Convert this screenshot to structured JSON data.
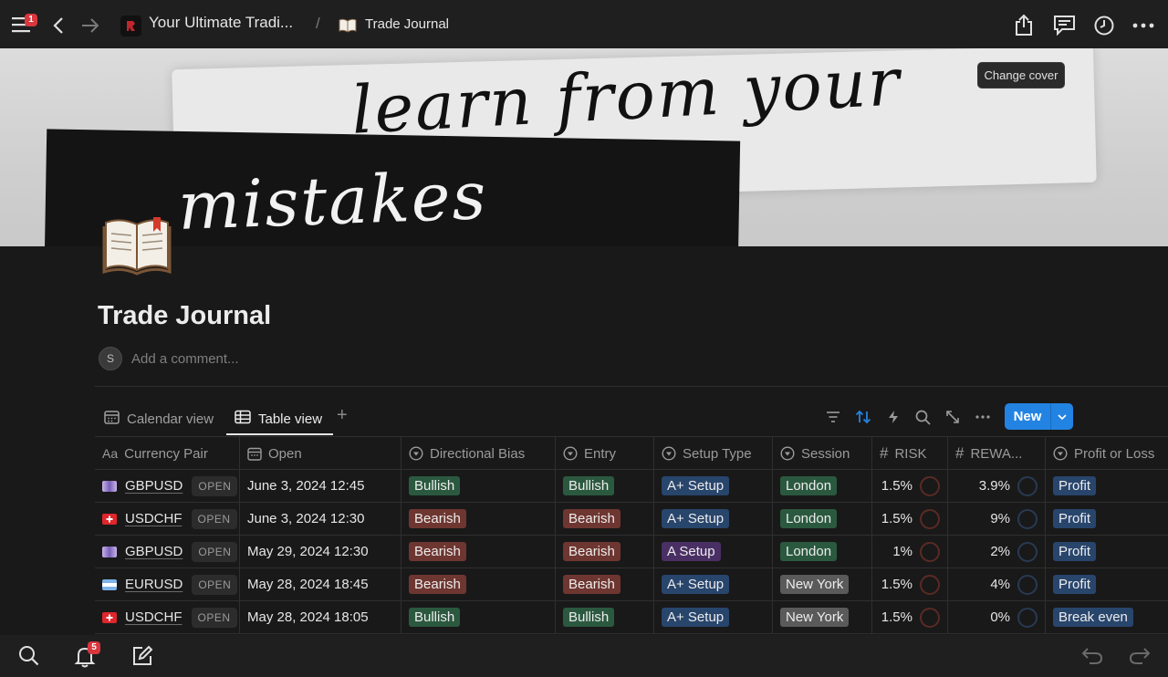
{
  "topbar": {
    "menu_badge": "1",
    "breadcrumb_workspace": "Your Ultimate Tradi...",
    "breadcrumb_separator": "/",
    "breadcrumb_page": "Trade Journal",
    "icons": [
      "menu-icon",
      "back-icon",
      "forward-icon",
      "share-icon",
      "comments-icon",
      "history-icon",
      "more-icon"
    ]
  },
  "cover": {
    "line1": "learn from your",
    "line2": "mistakes",
    "change_cover_label": "Change cover"
  },
  "page": {
    "title": "Trade Journal",
    "avatar_initial": "S",
    "comment_placeholder": "Add a comment..."
  },
  "views": {
    "tabs": [
      {
        "label": "Calendar view",
        "icon": "calendar-icon",
        "active": false
      },
      {
        "label": "Table view",
        "icon": "table-icon",
        "active": true
      }
    ],
    "new_label": "New",
    "toolbar_icons": [
      "filter-icon",
      "sort-icon",
      "automation-icon",
      "search-icon",
      "expand-icon",
      "more-icon"
    ]
  },
  "table": {
    "columns": [
      {
        "label": "Currency Pair",
        "icon": "Aa"
      },
      {
        "label": "Open",
        "icon": "calendar-icon"
      },
      {
        "label": "Directional Bias",
        "icon": "select-icon"
      },
      {
        "label": "Entry",
        "icon": "select-icon"
      },
      {
        "label": "Setup Type",
        "icon": "select-icon"
      },
      {
        "label": "Session",
        "icon": "select-icon"
      },
      {
        "label": "RISK",
        "icon": "#"
      },
      {
        "label": "REWA...",
        "icon": "#"
      },
      {
        "label": "Profit or Loss",
        "icon": "select-icon"
      }
    ],
    "open_label": "OPEN",
    "rows": [
      {
        "pair": "GBPUSD",
        "date": "June 3, 2024 12:45",
        "bias": "Bullish",
        "entry": "Bullish",
        "setup": "A+ Setup",
        "session": "London",
        "risk": "1.5%",
        "reward": "3.9%",
        "result": "Profit"
      },
      {
        "pair": "USDCHF",
        "date": "June 3, 2024 12:30",
        "bias": "Bearish",
        "entry": "Bearish",
        "setup": "A+ Setup",
        "session": "London",
        "risk": "1.5%",
        "reward": "9%",
        "result": "Profit"
      },
      {
        "pair": "GBPUSD",
        "date": "May 29, 2024 12:30",
        "bias": "Bearish",
        "entry": "Bearish",
        "setup": "A Setup",
        "session": "London",
        "risk": "1%",
        "reward": "2%",
        "result": "Profit"
      },
      {
        "pair": "EURUSD",
        "date": "May 28, 2024 18:45",
        "bias": "Bearish",
        "entry": "Bearish",
        "setup": "A+ Setup",
        "session": "New York",
        "risk": "1.5%",
        "reward": "4%",
        "result": "Profit"
      },
      {
        "pair": "USDCHF",
        "date": "May 28, 2024 18:05",
        "bias": "Bullish",
        "entry": "Bullish",
        "setup": "A+ Setup",
        "session": "New York",
        "risk": "1.5%",
        "reward": "0%",
        "result": "Break even"
      }
    ]
  },
  "bottombar": {
    "notifications_badge": "5",
    "icons": [
      "search-icon",
      "bell-icon",
      "compose-icon",
      "undo-icon",
      "redo-icon"
    ]
  },
  "colors": {
    "accent": "#2383e2",
    "badge": "#d9363e",
    "bullish_tag": "#2b593f",
    "bearish_tag": "#6e3630",
    "setup_tag": "#28456c",
    "a_setup_tag": "#492f64",
    "newyork_tag": "#5a5a5a"
  }
}
